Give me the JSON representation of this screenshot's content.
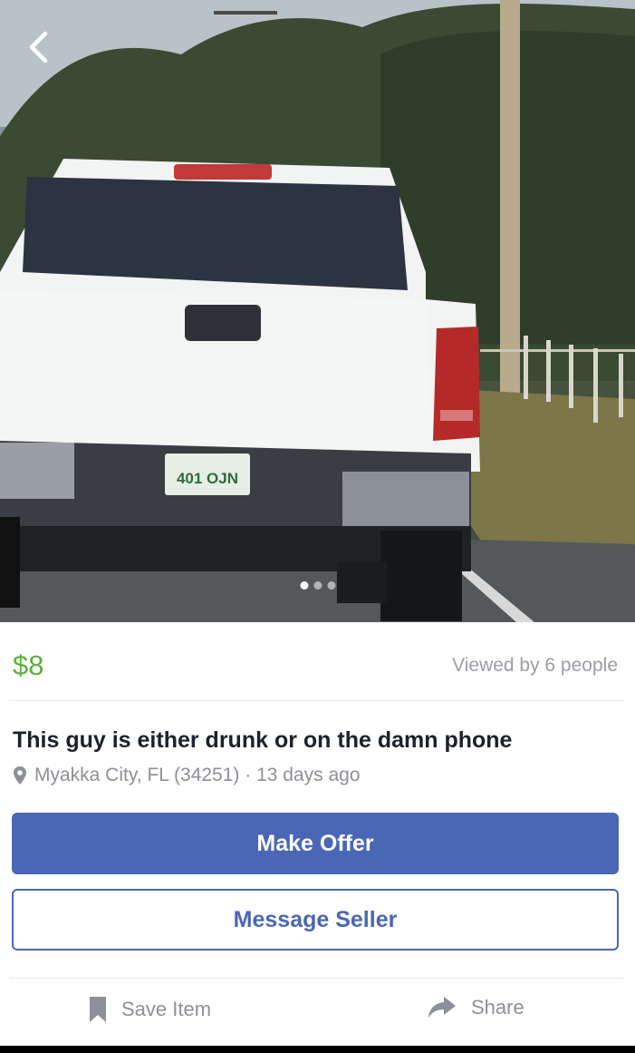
{
  "photo": {
    "alt": "listing photo",
    "carousel_count": 3,
    "carousel_active_index": 0,
    "back_icon": "chevron-left-icon"
  },
  "listing": {
    "price": "$8",
    "price_color": "#5cb03a",
    "views": "Viewed by 6 people",
    "title": "This guy is either drunk or on the damn phone",
    "location": "Myakka City, FL (34251) · 13 days ago",
    "location_icon": "map-pin-icon"
  },
  "actions": {
    "make_offer": "Make Offer",
    "message_seller": "Message Seller",
    "save_item": "Save Item",
    "share": "Share",
    "accent_color": "#4a67b6"
  }
}
